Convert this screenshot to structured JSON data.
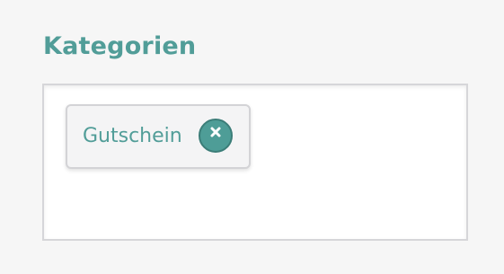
{
  "section": {
    "title": "Kategorien"
  },
  "tags": [
    {
      "label": "Gutschein",
      "remove_icon": "close-icon"
    }
  ],
  "colors": {
    "accent": "#519d98",
    "remove_button": "#4e9d97",
    "page_background": "#f6f6f6"
  }
}
